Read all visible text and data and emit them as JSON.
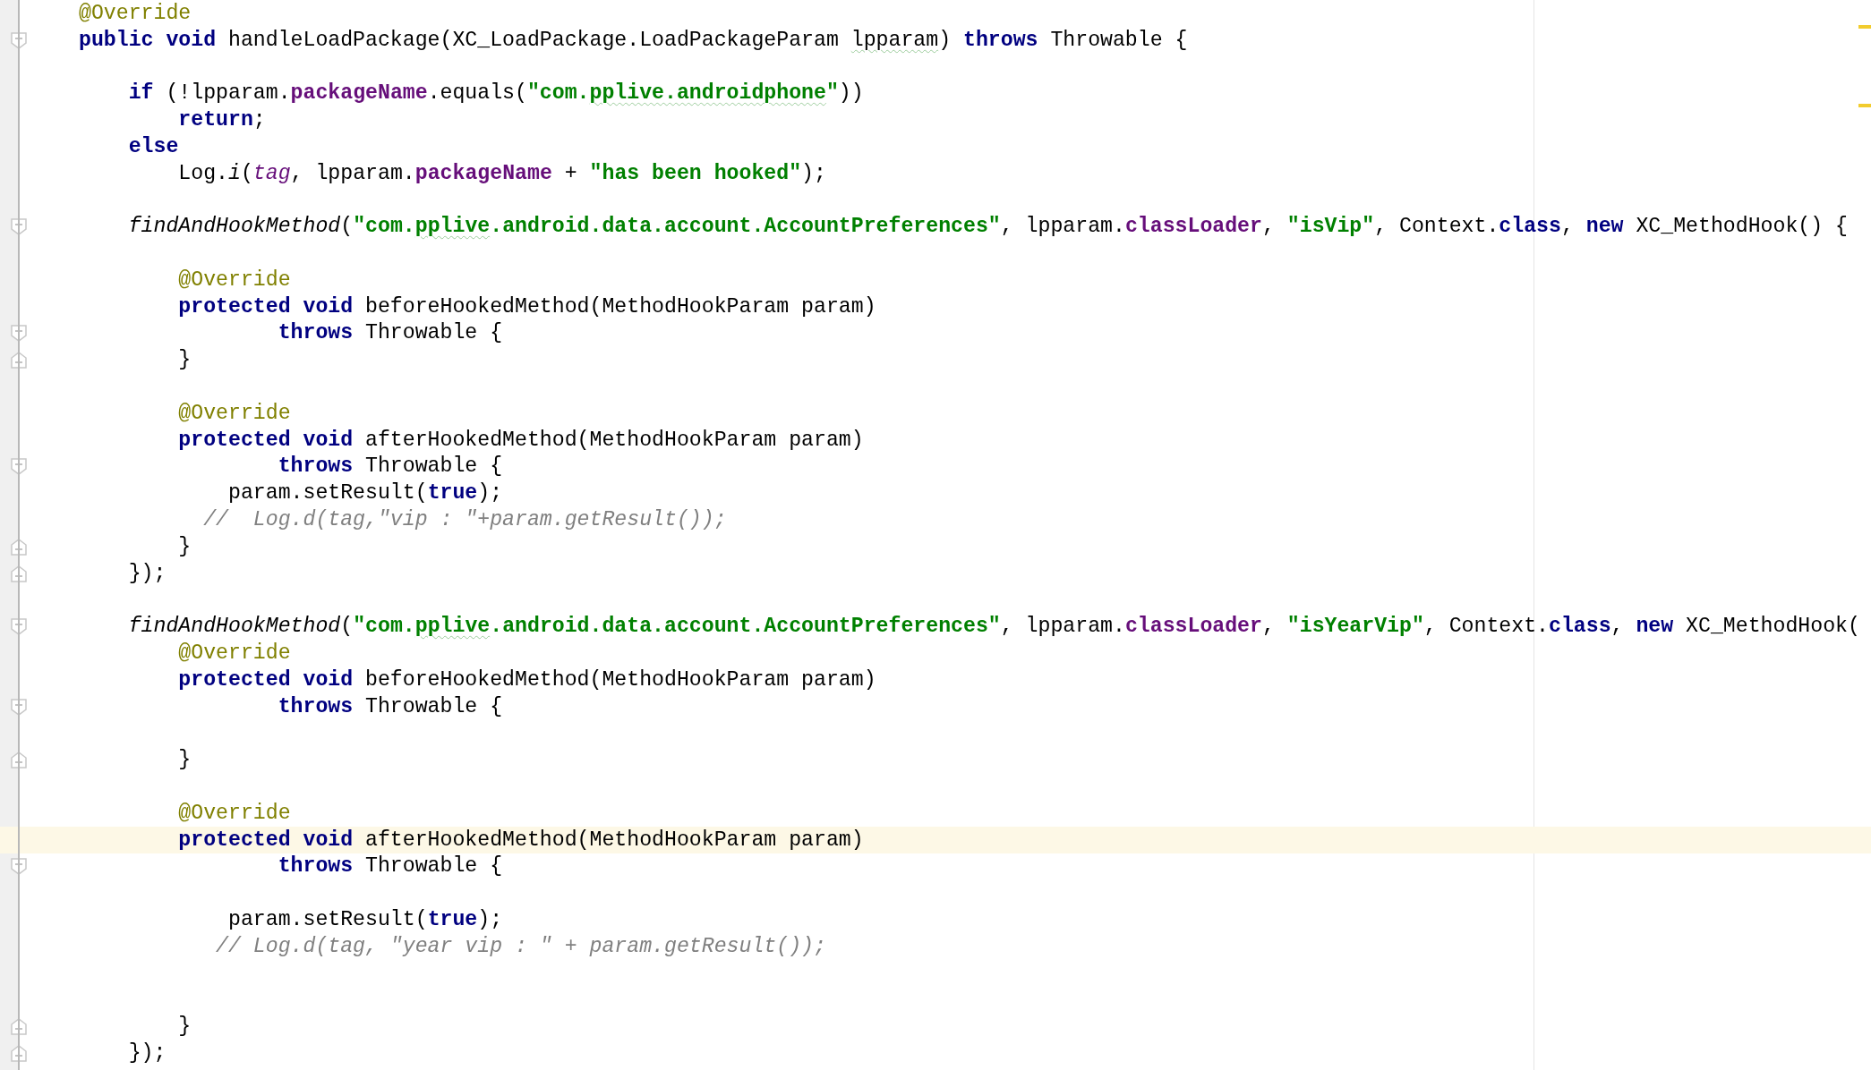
{
  "lines": [
    {
      "current": false,
      "tokens": [
        {
          "kind": "ann",
          "text": "@Override"
        }
      ]
    },
    {
      "current": false,
      "fold_start": true,
      "tokens": [
        {
          "kind": "kw",
          "text": "public void"
        },
        {
          "kind": "plain",
          "text": " handleLoadPackage(XC_LoadPackage.LoadPackageParam "
        },
        {
          "kind": "plain",
          "text": "lpparam",
          "typo": true
        },
        {
          "kind": "plain",
          "text": ") "
        },
        {
          "kind": "kw",
          "text": "throws"
        },
        {
          "kind": "plain",
          "text": " Throwable {"
        }
      ]
    },
    {
      "current": false
    },
    {
      "current": false,
      "tokens": [
        {
          "kind": "kw",
          "text": "    if"
        },
        {
          "kind": "plain",
          "text": " (!lpparam."
        },
        {
          "kind": "field",
          "text": "packageName"
        },
        {
          "kind": "plain",
          "text": ".equals("
        },
        {
          "kind": "str",
          "text": "\"com."
        },
        {
          "kind": "str",
          "text": "pplive.androidphone",
          "typo": true
        },
        {
          "kind": "str",
          "text": "\""
        },
        {
          "kind": "plain",
          "text": "))"
        }
      ]
    },
    {
      "current": false,
      "tokens": [
        {
          "kind": "kw",
          "text": "        return"
        },
        {
          "kind": "plain",
          "text": ";"
        }
      ]
    },
    {
      "current": false,
      "tokens": [
        {
          "kind": "kw",
          "text": "    else"
        }
      ]
    },
    {
      "current": false,
      "tokens": [
        {
          "kind": "plain",
          "text": "        Log."
        },
        {
          "kind": "italic",
          "text": "i"
        },
        {
          "kind": "plain",
          "text": "("
        },
        {
          "kind": "static",
          "text": "tag"
        },
        {
          "kind": "plain",
          "text": ", lpparam."
        },
        {
          "kind": "field",
          "text": "packageName"
        },
        {
          "kind": "plain",
          "text": " + "
        },
        {
          "kind": "str",
          "text": "\"has been hooked\""
        },
        {
          "kind": "plain",
          "text": ");"
        }
      ]
    },
    {
      "current": false
    },
    {
      "current": false,
      "fold_start": true,
      "tokens": [
        {
          "kind": "italic",
          "text": "    findAndHookMethod"
        },
        {
          "kind": "plain",
          "text": "("
        },
        {
          "kind": "str",
          "text": "\"com."
        },
        {
          "kind": "str",
          "text": "pplive",
          "typo": true
        },
        {
          "kind": "str",
          "text": ".android.data.account.AccountPreferences\""
        },
        {
          "kind": "plain",
          "text": ", lpparam."
        },
        {
          "kind": "field",
          "text": "classLoader"
        },
        {
          "kind": "plain",
          "text": ", "
        },
        {
          "kind": "str",
          "text": "\"isVip\""
        },
        {
          "kind": "plain",
          "text": ", Context."
        },
        {
          "kind": "kw",
          "text": "class"
        },
        {
          "kind": "plain",
          "text": ", "
        },
        {
          "kind": "kw",
          "text": "new"
        },
        {
          "kind": "plain",
          "text": " XC_MethodHook() {"
        }
      ]
    },
    {
      "current": false
    },
    {
      "current": false,
      "tokens": [
        {
          "kind": "ann",
          "text": "        @Override"
        }
      ]
    },
    {
      "current": false,
      "tokens": [
        {
          "kind": "kw",
          "text": "        protected void"
        },
        {
          "kind": "plain",
          "text": " beforeHookedMethod(MethodHookParam param)"
        }
      ]
    },
    {
      "current": false,
      "fold_start": true,
      "tokens": [
        {
          "kind": "kw",
          "text": "                throws"
        },
        {
          "kind": "plain",
          "text": " Throwable {"
        }
      ]
    },
    {
      "current": false,
      "fold_end": true,
      "tokens": [
        {
          "kind": "plain",
          "text": "        }"
        }
      ]
    },
    {
      "current": false
    },
    {
      "current": false,
      "tokens": [
        {
          "kind": "ann",
          "text": "        @Override"
        }
      ]
    },
    {
      "current": false,
      "tokens": [
        {
          "kind": "kw",
          "text": "        protected void"
        },
        {
          "kind": "plain",
          "text": " afterHookedMethod(MethodHookParam param)"
        }
      ]
    },
    {
      "current": false,
      "fold_start": true,
      "tokens": [
        {
          "kind": "kw",
          "text": "                throws"
        },
        {
          "kind": "plain",
          "text": " Throwable {"
        }
      ]
    },
    {
      "current": false,
      "tokens": [
        {
          "kind": "plain",
          "text": "            param.setResult("
        },
        {
          "kind": "kw",
          "text": "true"
        },
        {
          "kind": "plain",
          "text": ");"
        }
      ]
    },
    {
      "current": false,
      "tokens": [
        {
          "kind": "comment",
          "text": "          //  Log.d(tag,\"vip : \"+param.getResult());"
        }
      ]
    },
    {
      "current": false,
      "fold_end": true,
      "tokens": [
        {
          "kind": "plain",
          "text": "        }"
        }
      ]
    },
    {
      "current": false,
      "fold_end": true,
      "tokens": [
        {
          "kind": "plain",
          "text": "    });"
        }
      ]
    },
    {
      "current": false
    },
    {
      "current": false,
      "fold_start": true,
      "tokens": [
        {
          "kind": "italic",
          "text": "    findAndHookMethod"
        },
        {
          "kind": "plain",
          "text": "("
        },
        {
          "kind": "str",
          "text": "\"com."
        },
        {
          "kind": "str",
          "text": "pplive",
          "typo": true
        },
        {
          "kind": "str",
          "text": ".android.data.account.AccountPreferences\""
        },
        {
          "kind": "plain",
          "text": ", lpparam."
        },
        {
          "kind": "field",
          "text": "classLoader"
        },
        {
          "kind": "plain",
          "text": ", "
        },
        {
          "kind": "str",
          "text": "\"isYearVip\""
        },
        {
          "kind": "plain",
          "text": ", Context."
        },
        {
          "kind": "kw",
          "text": "class"
        },
        {
          "kind": "plain",
          "text": ", "
        },
        {
          "kind": "kw",
          "text": "new"
        },
        {
          "kind": "plain",
          "text": " XC_MethodHook("
        }
      ]
    },
    {
      "current": false,
      "tokens": [
        {
          "kind": "ann",
          "text": "        @Override"
        }
      ]
    },
    {
      "current": false,
      "tokens": [
        {
          "kind": "kw",
          "text": "        protected void"
        },
        {
          "kind": "plain",
          "text": " beforeHookedMethod(MethodHookParam param)"
        }
      ]
    },
    {
      "current": false,
      "fold_start": true,
      "tokens": [
        {
          "kind": "kw",
          "text": "                throws"
        },
        {
          "kind": "plain",
          "text": " Throwable {"
        }
      ]
    },
    {
      "current": false
    },
    {
      "current": false,
      "fold_end": true,
      "tokens": [
        {
          "kind": "plain",
          "text": "        }"
        }
      ]
    },
    {
      "current": false
    },
    {
      "current": false,
      "tokens": [
        {
          "kind": "ann",
          "text": "        @Override"
        }
      ]
    },
    {
      "current": true,
      "tokens": [
        {
          "kind": "kw",
          "text": "        protected void"
        },
        {
          "kind": "plain",
          "text": " afterHookedMethod(MethodHookParam param)"
        }
      ]
    },
    {
      "current": false,
      "fold_start": true,
      "tokens": [
        {
          "kind": "kw",
          "text": "                throws"
        },
        {
          "kind": "plain",
          "text": " Throwable {"
        }
      ]
    },
    {
      "current": false
    },
    {
      "current": false,
      "tokens": [
        {
          "kind": "plain",
          "text": "            param.setResult("
        },
        {
          "kind": "kw",
          "text": "true"
        },
        {
          "kind": "plain",
          "text": ");"
        }
      ]
    },
    {
      "current": false,
      "tokens": [
        {
          "kind": "comment",
          "text": "           // Log.d(tag, \"year vip : \" + param.getResult());"
        }
      ]
    },
    {
      "current": false
    },
    {
      "current": false
    },
    {
      "current": false,
      "fold_end": true,
      "tokens": [
        {
          "kind": "plain",
          "text": "        }"
        }
      ]
    },
    {
      "current": false,
      "fold_end": true,
      "tokens": [
        {
          "kind": "plain",
          "text": "    });"
        }
      ]
    }
  ]
}
